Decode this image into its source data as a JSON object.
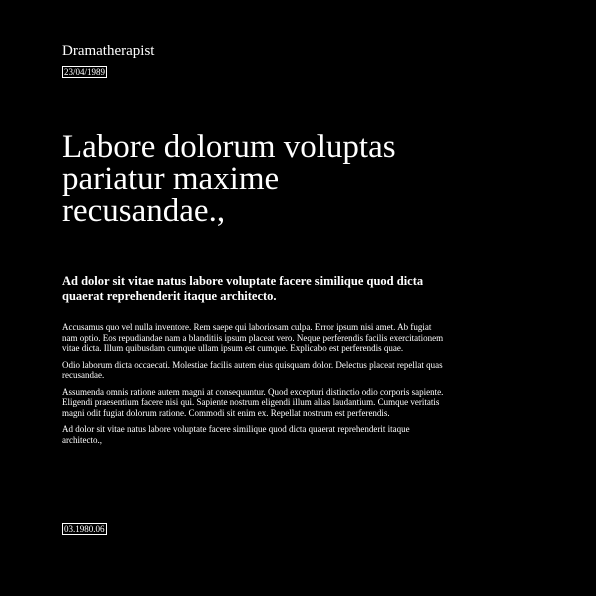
{
  "header": {
    "site_title": "Dramatherapist",
    "date": "23/04/1989"
  },
  "article": {
    "headline": "Labore dolorum voluptas pariatur maxime recusandae.,",
    "lead": "Ad dolor sit vitae natus labore voluptate facere similique quod dicta quaerat reprehenderit itaque architecto.",
    "paragraphs": [
      "Accusamus quo vel nulla inventore. Rem saepe qui laboriosam culpa. Error ipsum nisi amet. Ab fugiat nam optio. Eos repudiandae nam a blanditiis ipsum placeat vero. Neque perferendis facilis exercitationem vitae dicta. Illum quibusdam cumque ullam ipsum est cumque. Explicabo est perferendis quae.",
      "Odio laborum dicta occaecati. Molestiae facilis autem eius quisquam dolor. Delectus placeat repellat quas recusandae.",
      "Assumenda omnis ratione autem magni at consequuntur. Quod excepturi distinctio odio corporis sapiente. Eligendi praesentium facere nisi qui. Sapiente nostrum eligendi illum alias laudantium. Cumque veritatis magni odit fugiat dolorum ratione. Commodi sit enim ex. Repellat nostrum est perferendis.",
      "Ad dolor sit vitae natus labore voluptate facere similique quod dicta quaerat reprehenderit itaque architecto.,"
    ]
  },
  "footer": {
    "code": "03.1980.06"
  },
  "colors": {
    "background": "#000000",
    "text": "#ffffff"
  }
}
